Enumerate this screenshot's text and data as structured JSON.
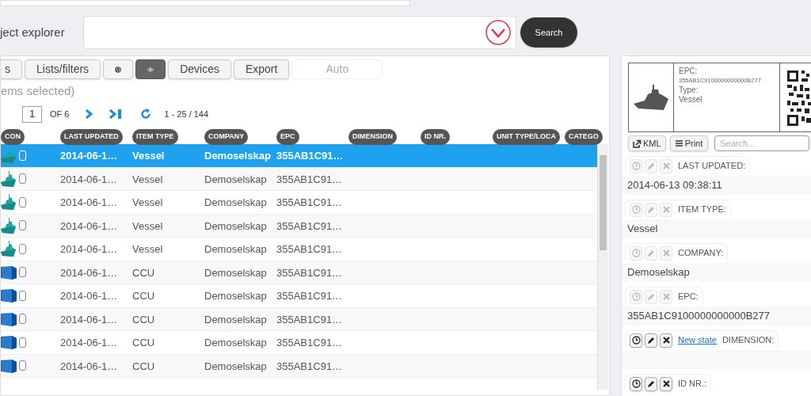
{
  "page_title": "ject explorer",
  "search": {
    "button": "Search"
  },
  "toolbar": [
    {
      "kind": "text",
      "label": "s"
    },
    {
      "kind": "text",
      "label": "Lists/filters"
    },
    {
      "kind": "globe",
      "selected": false
    },
    {
      "kind": "eye",
      "selected": true
    },
    {
      "kind": "text",
      "label": "Devices"
    },
    {
      "kind": "text",
      "label": "Export"
    },
    {
      "kind": "disabled",
      "label": "Auto"
    }
  ],
  "selection_note": "ems selected)",
  "pager": {
    "page": "1",
    "of": "OF 6",
    "range": "1 - 25 / 144"
  },
  "table": {
    "columns": [
      "CON",
      "LAST UPDATED",
      "ITEM TYPE",
      "COMPANY",
      "EPC",
      "DIMENSION",
      "ID NR.",
      "UNIT TYPE/LOCA",
      "CATEGO"
    ],
    "rows": [
      {
        "kind": "vessel",
        "selected": true,
        "checked": false,
        "cells": [
          "",
          "2014-06-1…",
          "Vessel",
          "Demoselskap",
          "355AB1C91…"
        ]
      },
      {
        "kind": "vessel",
        "selected": false,
        "checked": false,
        "cells": [
          "",
          "2014-06-1…",
          "Vessel",
          "Demoselskap",
          "355AB1C91…"
        ]
      },
      {
        "kind": "vessel",
        "selected": false,
        "checked": false,
        "cells": [
          "",
          "2014-06-1…",
          "Vessel",
          "Demoselskap",
          "355AB1C91…"
        ]
      },
      {
        "kind": "vessel",
        "selected": false,
        "checked": false,
        "cells": [
          "",
          "2014-06-1…",
          "Vessel",
          "Demoselskap",
          "355AB1C91…"
        ]
      },
      {
        "kind": "vessel",
        "selected": false,
        "checked": false,
        "cells": [
          "",
          "2014-06-1…",
          "Vessel",
          "Demoselskap",
          "355AB1C91…"
        ]
      },
      {
        "kind": "container",
        "selected": false,
        "checked": false,
        "cells": [
          "",
          "2014-06-1…",
          "CCU",
          "Demoselskap",
          "355AB1C91…"
        ]
      },
      {
        "kind": "container",
        "selected": false,
        "checked": false,
        "cells": [
          "",
          "2014-06-1…",
          "CCU",
          "Demoselskap",
          "355AB1C91…"
        ]
      },
      {
        "kind": "container",
        "selected": false,
        "checked": false,
        "cells": [
          "",
          "2014-06-1…",
          "CCU",
          "Demoselskap",
          "355AB1C91…"
        ]
      },
      {
        "kind": "container",
        "selected": false,
        "checked": false,
        "cells": [
          "",
          "2014-06-1…",
          "CCU",
          "Demoselskap",
          "355AB1C91…"
        ]
      },
      {
        "kind": "container",
        "selected": false,
        "checked": false,
        "cells": [
          "",
          "2014-06-1…",
          "CCU",
          "Demoselskap",
          "355AB1C91…"
        ]
      }
    ]
  },
  "detail": {
    "card": {
      "epc_label": "EPC:",
      "epc": "355AB1C9100000000000B277",
      "type_label": "Type:",
      "type": "Vessel"
    },
    "kml_button": "KML",
    "print_button": "Print",
    "search_placeholder": "Search...",
    "fields": [
      {
        "label": "LAST UPDATED:",
        "value": "2014-06-13 09:38:11",
        "active": false
      },
      {
        "label": "ITEM TYPE:",
        "value": "Vessel",
        "active": false
      },
      {
        "label": "COMPANY:",
        "value": "Demoselskap",
        "active": false
      },
      {
        "label": "EPC:",
        "value": "355AB1C9100000000000B277",
        "active": false
      },
      {
        "label": "DIMENSION:",
        "link": "New state",
        "active": true
      },
      {
        "label": "ID NR.:",
        "active": true
      }
    ]
  }
}
